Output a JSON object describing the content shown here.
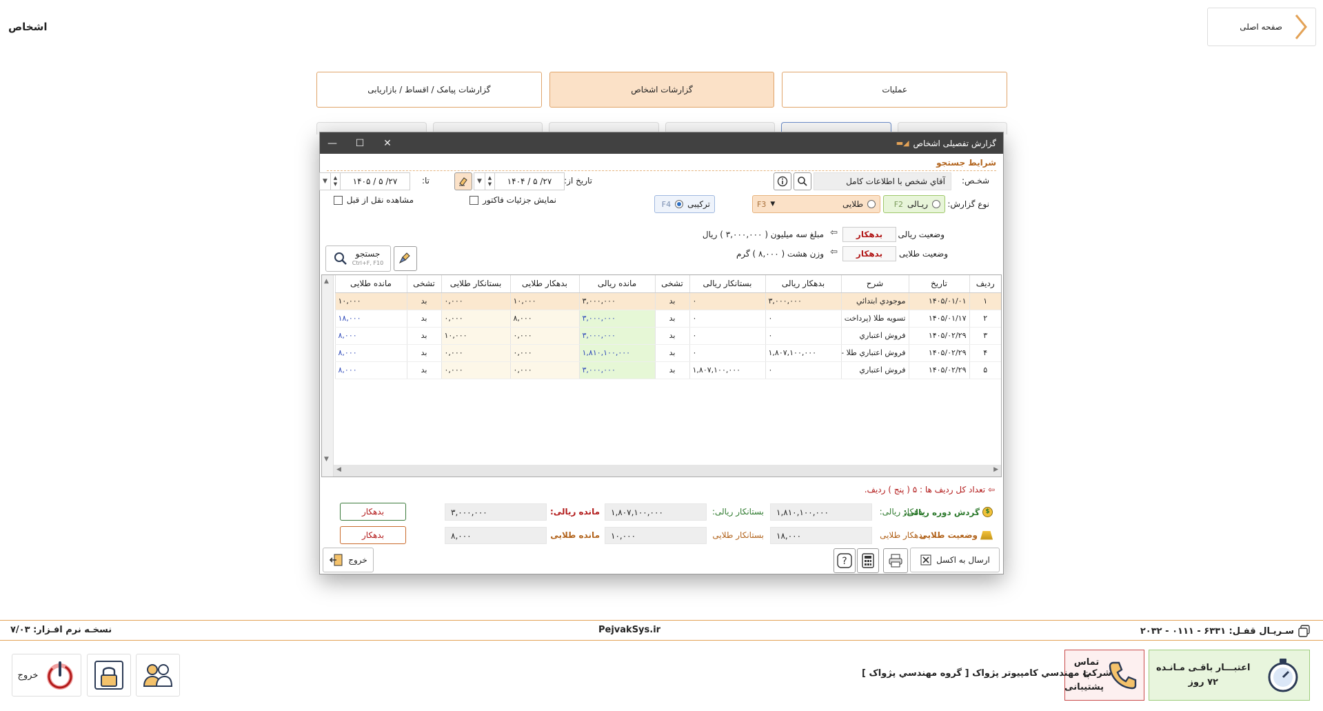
{
  "page": {
    "title": "اشخاص",
    "home_label": "صفحه اصلی"
  },
  "tabs": [
    {
      "label": "عملیات"
    },
    {
      "label": "گزارشات اشخاص"
    },
    {
      "label": "گزارشات پیامک / اقساط / بازاریابی"
    }
  ],
  "dialog": {
    "title": "گزارش تفصیلی اشخاص",
    "section_title": "شرایط جستجو",
    "person_label": "شخـص:",
    "person_value": "آقاي شخص با اطلاعات كامل",
    "date_from_label": "تاریخ از:",
    "date_from": "۱۴۰۴ / ۵ /۲۷",
    "date_to_label": "تا:",
    "date_to": "۱۴۰۵ / ۵ /۲۷",
    "show_invoice_details": "نمایش جزئیات فاکتور",
    "show_carryover": "مشاهده نقل از قبل",
    "report_type_label": "نوع گزارش:",
    "report_types": [
      {
        "label": "ریـالی",
        "key": "F2"
      },
      {
        "label": "طلایی",
        "key": "F3"
      },
      {
        "label": "ترکیبی",
        "key": "F4"
      }
    ],
    "rial_status_label": "وضعیت ریالی",
    "rial_status": "بدهکار",
    "rial_status_text": "مبلغ سه میلیون ( ۳,۰۰۰,۰۰۰ ) ریال",
    "gold_status_label": "وضعیت طلایی",
    "gold_status": "بدهکار",
    "gold_status_text": "وزن هشت ( ۸,۰۰۰ ) گرم",
    "search_button": "جستجو",
    "search_shortcut": "Ctrl+F, F10",
    "table": {
      "columns": [
        "ردیف",
        "تاریخ",
        "شرح",
        "بدهکار ریالی",
        "بستانکار ریالی",
        "تشخی",
        "مانده ریالی",
        "بدهکار طلایی",
        "بستانکار طلایی",
        "تشخی",
        "مانده طلایی"
      ],
      "rows": [
        [
          "۱",
          "۱۴۰۵/۰۱/۰۱",
          "موجودي ابتدائي",
          "۳,۰۰۰,۰۰۰",
          "۰",
          "بد",
          "۳,۰۰۰,۰۰۰",
          "۱۰,۰۰۰",
          "۰,۰۰۰",
          "بد",
          "۱۰,۰۰۰"
        ],
        [
          "۲",
          "۱۴۰۵/۰۱/۱۷",
          "تسویه طلا (پرداخت",
          "۰",
          "۰",
          "بد",
          "۳,۰۰۰,۰۰۰",
          "۸,۰۰۰",
          "۰,۰۰۰",
          "بد",
          "۱۸,۰۰۰"
        ],
        [
          "۳",
          "۱۴۰۵/۰۲/۲۹",
          "فروش اعتباري",
          "۰",
          "۰",
          "بد",
          "۳,۰۰۰,۰۰۰",
          "۰,۰۰۰",
          "۱۰,۰۰۰",
          "بد",
          "۸,۰۰۰"
        ],
        [
          "۴",
          "۱۴۰۵/۰۲/۲۹",
          "فروش اعتباري طلا -",
          "۱,۸۰۷,۱۰۰,۰۰۰",
          "۰",
          "بد",
          "۱,۸۱۰,۱۰۰,۰۰۰",
          "۰,۰۰۰",
          "۰,۰۰۰",
          "بد",
          "۸,۰۰۰"
        ],
        [
          "۵",
          "۱۴۰۵/۰۲/۲۹",
          "فروش اعتباري",
          "۰",
          "۱,۸۰۷,۱۰۰,۰۰۰",
          "بد",
          "۳,۰۰۰,۰۰۰",
          "۰,۰۰۰",
          "۰,۰۰۰",
          "بد",
          "۸,۰۰۰"
        ]
      ]
    },
    "row_count_text": "تعداد کل ردیف ها : ۵ ( پنج ) ردیف.",
    "summary": {
      "rial_turnover_label": "گردش دوره ریالی:",
      "rial_debit_label": "بدهکار ریالی:",
      "rial_debit": "۱,۸۱۰,۱۰۰,۰۰۰",
      "rial_credit_label": "بستانکار ریالی:",
      "rial_credit": "۱,۸۰۷,۱۰۰,۰۰۰",
      "rial_balance_label": "مانده ریالی:",
      "rial_balance": "۳,۰۰۰,۰۰۰",
      "rial_status": "بدهکار",
      "gold_status_label": "وضعیت طلایی",
      "gold_debit_label": "بدهکار طلایی",
      "gold_debit": "۱۸,۰۰۰",
      "gold_credit_label": "بستانکار طلایی",
      "gold_credit": "۱۰,۰۰۰",
      "gold_balance_label": "مانده طلایی",
      "gold_balance": "۸,۰۰۰",
      "gold_status": "بدهکار"
    },
    "excel_button": "ارسال به اکسل",
    "exit_button": "خروج"
  },
  "footer": {
    "serial": "سـریـال قفـل: ۶۳۳۱ - ۰۱۱۱ - ۲۰۳۲",
    "website": "PejvakSys.ir",
    "version": "نسخـه نرم افـزار: ۷/۰۳",
    "credit_label": "اعتبـــار باقـی مـانـده",
    "credit_days": "۷۲ روز",
    "support_label": "تماس با پشتیبانی",
    "company": "شرکت مهندسي کامپيوتر پژواک [ گروه مهندسي پژواک ]",
    "exit_label": "خروج"
  },
  "colors": {
    "accent": "#e3a256",
    "active_tab": "#fbe1c7",
    "debit_red": "#b21a1a",
    "green_cell": "#e6f7d6"
  }
}
